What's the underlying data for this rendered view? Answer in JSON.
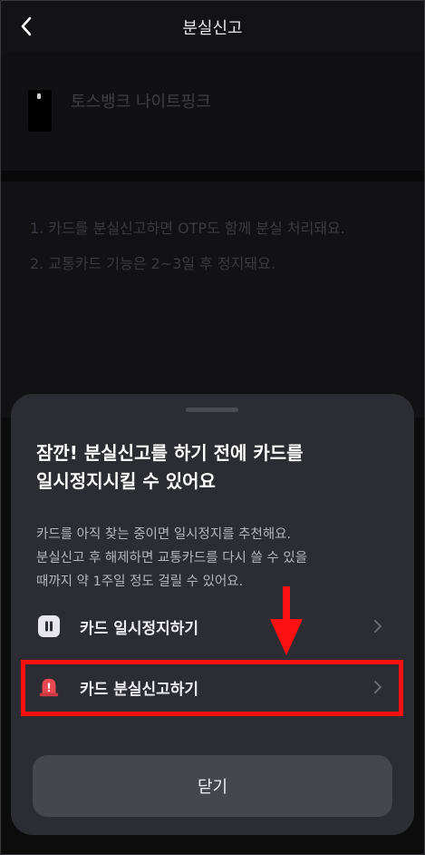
{
  "header": {
    "title": "분실신고"
  },
  "card": {
    "name": "토스뱅크 나이트핑크"
  },
  "notices": [
    "1.  카드를 분실신고하면 OTP도 함께 분실 처리돼요.",
    "2.  교통카드 기능은 2~3일 후 정지돼요."
  ],
  "sheet": {
    "title_line1": "잠깐! 분실신고를 하기 전에 카드를",
    "title_line2": "일시정지시킬 수 있어요",
    "desc_line1": "카드를 아직 찾는 중이면 일시정지를 추천해요.",
    "desc_line2": "분실신고 후 해제하면 교통카드를 다시 쓸 수 있을",
    "desc_line3": "때까지 약 1주일 정도 걸릴 수 있어요.",
    "options": [
      {
        "label": "카드 일시정지하기",
        "icon": "pause-icon"
      },
      {
        "label": "카드 분실신고하기",
        "icon": "siren-icon"
      }
    ],
    "close_label": "닫기"
  },
  "colors": {
    "background": "#0c0c0d",
    "sheet": "#2c2c33",
    "highlight": "#ff1010",
    "siren": "#e8484f"
  }
}
